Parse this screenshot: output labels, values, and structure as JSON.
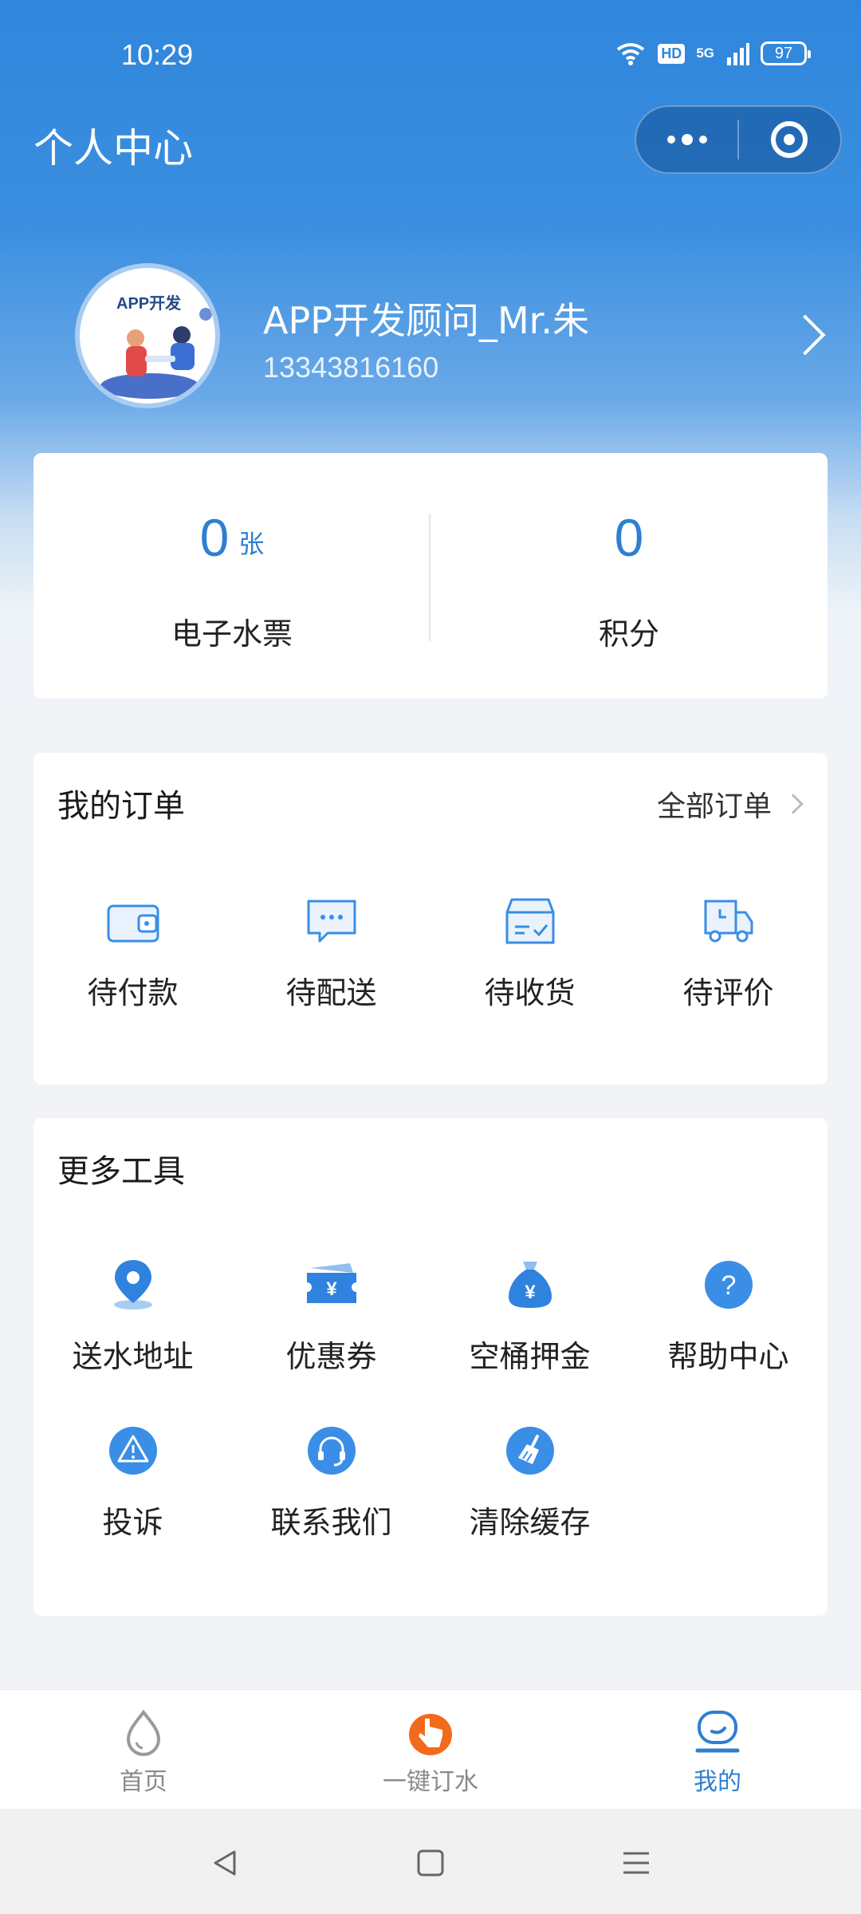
{
  "status_bar": {
    "time": "10:29",
    "hd": "HD",
    "network": "5G",
    "battery": "97"
  },
  "nav": {
    "title": "个人中心",
    "capsule_icons": [
      "more-dots-icon",
      "target-icon"
    ]
  },
  "profile": {
    "avatar_text": "APP开发",
    "name": "APP开发顾问_Mr.朱",
    "phone": "13343816160"
  },
  "stats": [
    {
      "value": "0",
      "unit": "张",
      "label": "电子水票"
    },
    {
      "value": "0",
      "unit": "",
      "label": "积分"
    }
  ],
  "orders": {
    "title": "我的订单",
    "all_link": "全部订单",
    "items": [
      {
        "label": "待付款",
        "icon": "wallet-icon"
      },
      {
        "label": "待配送",
        "icon": "chat-bubble-icon"
      },
      {
        "label": "待收货",
        "icon": "box-icon"
      },
      {
        "label": "待评价",
        "icon": "truck-icon"
      }
    ]
  },
  "tools": {
    "title": "更多工具",
    "items": [
      {
        "label": "送水地址",
        "icon": "location-pin-icon"
      },
      {
        "label": "优惠券",
        "icon": "coupon-icon"
      },
      {
        "label": "空桶押金",
        "icon": "money-bag-icon"
      },
      {
        "label": "帮助中心",
        "icon": "question-icon"
      },
      {
        "label": "投诉",
        "icon": "warning-icon"
      },
      {
        "label": "联系我们",
        "icon": "headset-icon"
      },
      {
        "label": "清除缓存",
        "icon": "broom-icon"
      }
    ]
  },
  "tabbar": {
    "tabs": [
      {
        "label": "首页",
        "icon": "water-drop-icon",
        "active": false
      },
      {
        "label": "一键订水",
        "icon": "tap-hand-icon",
        "active": false
      },
      {
        "label": "我的",
        "icon": "profile-icon",
        "active": true
      }
    ]
  },
  "colors": {
    "primary": "#2f7fd0",
    "header_blue": "#2f86db",
    "accent_orange": "#f26a1b",
    "icon_blue": "#3a8ee6"
  }
}
